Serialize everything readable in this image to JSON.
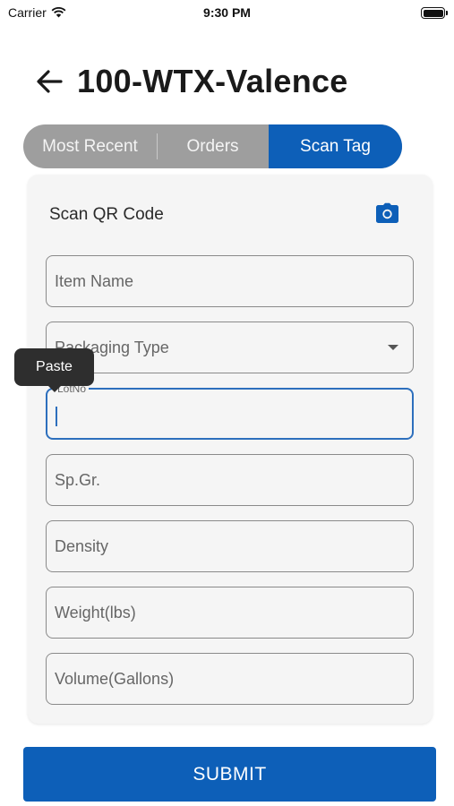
{
  "status_bar": {
    "carrier": "Carrier",
    "time": "9:30 PM",
    "icons": [
      "wifi-icon",
      "battery-icon"
    ]
  },
  "header": {
    "back_icon": "arrow-left-icon",
    "title": "100-WTX-Valence"
  },
  "tabs": [
    {
      "label": "Most Recent",
      "selected": false
    },
    {
      "label": "Orders",
      "selected": false
    },
    {
      "label": "Scan Tag",
      "selected": true
    }
  ],
  "scan": {
    "label": "Scan QR Code",
    "icon": "camera-icon"
  },
  "form": {
    "item_name": {
      "placeholder": "Item Name",
      "value": ""
    },
    "packaging_type": {
      "placeholder": "Packaging Type",
      "value": ""
    },
    "lot_no": {
      "label": "LotNo",
      "value": ""
    },
    "sp_gr": {
      "placeholder": "Sp.Gr.",
      "value": ""
    },
    "density": {
      "placeholder": "Density",
      "value": ""
    },
    "weight": {
      "placeholder": "Weight(lbs)",
      "value": ""
    },
    "volume": {
      "placeholder": "Volume(Gallons)",
      "value": ""
    }
  },
  "context_menu": {
    "paste_label": "Paste"
  },
  "submit_label": "SUBMIT",
  "colors": {
    "accent": "#0d5fb8",
    "segment_bg": "#9e9e9e",
    "focus_border": "#2d6fbd",
    "card_bg": "#f5f5f5"
  }
}
